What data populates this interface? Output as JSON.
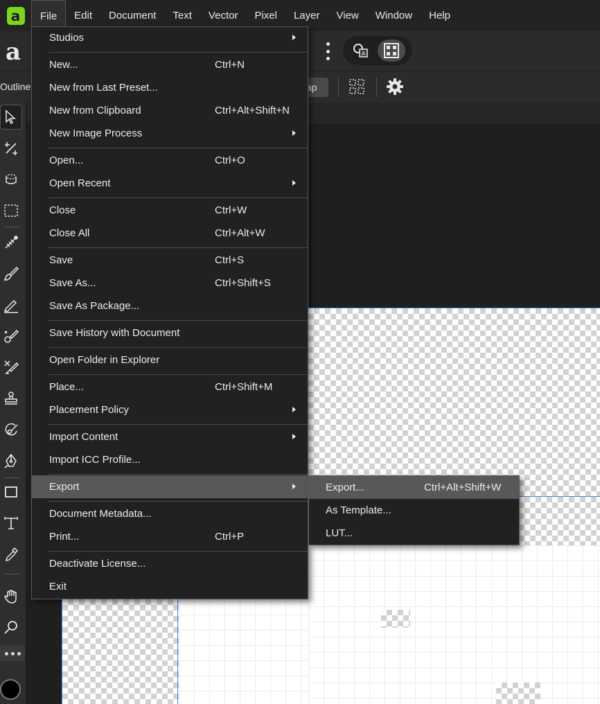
{
  "menubar": {
    "logo": "affinity-logo-icon",
    "items": [
      "File",
      "Edit",
      "Document",
      "Text",
      "Vector",
      "Pixel",
      "Layer",
      "View",
      "Window",
      "Help"
    ]
  },
  "toolbar": {
    "outline_label": "Outline",
    "snap_partial": "ap"
  },
  "file_menu": {
    "items": [
      {
        "label": "Studios",
        "shortcut": "",
        "submenu": true
      },
      {
        "label": "New...",
        "shortcut": "Ctrl+N",
        "submenu": false
      },
      {
        "label": "New from Last Preset...",
        "shortcut": "",
        "submenu": false
      },
      {
        "label": "New from Clipboard",
        "shortcut": "Ctrl+Alt+Shift+N",
        "submenu": false
      },
      {
        "label": "New Image Process",
        "shortcut": "",
        "submenu": true
      },
      {
        "label": "Open...",
        "shortcut": "Ctrl+O",
        "submenu": false
      },
      {
        "label": "Open Recent",
        "shortcut": "",
        "submenu": true
      },
      {
        "label": "Close",
        "shortcut": "Ctrl+W",
        "submenu": false
      },
      {
        "label": "Close All",
        "shortcut": "Ctrl+Alt+W",
        "submenu": false
      },
      {
        "label": "Save",
        "shortcut": "Ctrl+S",
        "submenu": false
      },
      {
        "label": "Save As...",
        "shortcut": "Ctrl+Shift+S",
        "submenu": false
      },
      {
        "label": "Save As Package...",
        "shortcut": "",
        "submenu": false
      },
      {
        "label": "Save History with Document",
        "shortcut": "",
        "submenu": false
      },
      {
        "label": "Open Folder in Explorer",
        "shortcut": "",
        "submenu": false
      },
      {
        "label": "Place...",
        "shortcut": "Ctrl+Shift+M",
        "submenu": false
      },
      {
        "label": "Placement Policy",
        "shortcut": "",
        "submenu": true
      },
      {
        "label": "Import Content",
        "shortcut": "",
        "submenu": true
      },
      {
        "label": "Import ICC Profile...",
        "shortcut": "",
        "submenu": false
      },
      {
        "label": "Export",
        "shortcut": "",
        "submenu": true,
        "highlighted": true
      },
      {
        "label": "Document Metadata...",
        "shortcut": "",
        "submenu": false
      },
      {
        "label": "Print...",
        "shortcut": "Ctrl+P",
        "submenu": false
      },
      {
        "label": "Deactivate License...",
        "shortcut": "",
        "submenu": false
      },
      {
        "label": "Exit",
        "shortcut": "",
        "submenu": false
      }
    ]
  },
  "export_submenu": {
    "items": [
      {
        "label": "Export...",
        "shortcut": "Ctrl+Alt+Shift+W",
        "highlighted": true
      },
      {
        "label": "As Template...",
        "shortcut": ""
      },
      {
        "label": "LUT...",
        "shortcut": ""
      }
    ]
  },
  "tools": [
    "move-tool-icon",
    "crop-tool-icon",
    "selection-brush-icon",
    "marquee-tool-icon",
    "gradient-tool-icon",
    "paint-brush-icon",
    "pencil-tool-icon",
    "retouch-brush-icon",
    "erase-brush-icon",
    "clone-stamp-icon",
    "healing-brush-icon",
    "pen-tool-icon",
    "rectangle-tool-icon",
    "text-tool-icon",
    "color-picker-icon",
    "hand-tool-icon",
    "zoom-tool-icon"
  ],
  "colors": {
    "accent": "#7ed321",
    "selection_line": "#3b8bea",
    "menu_bg": "#212121",
    "menu_highlight": "#585858"
  }
}
